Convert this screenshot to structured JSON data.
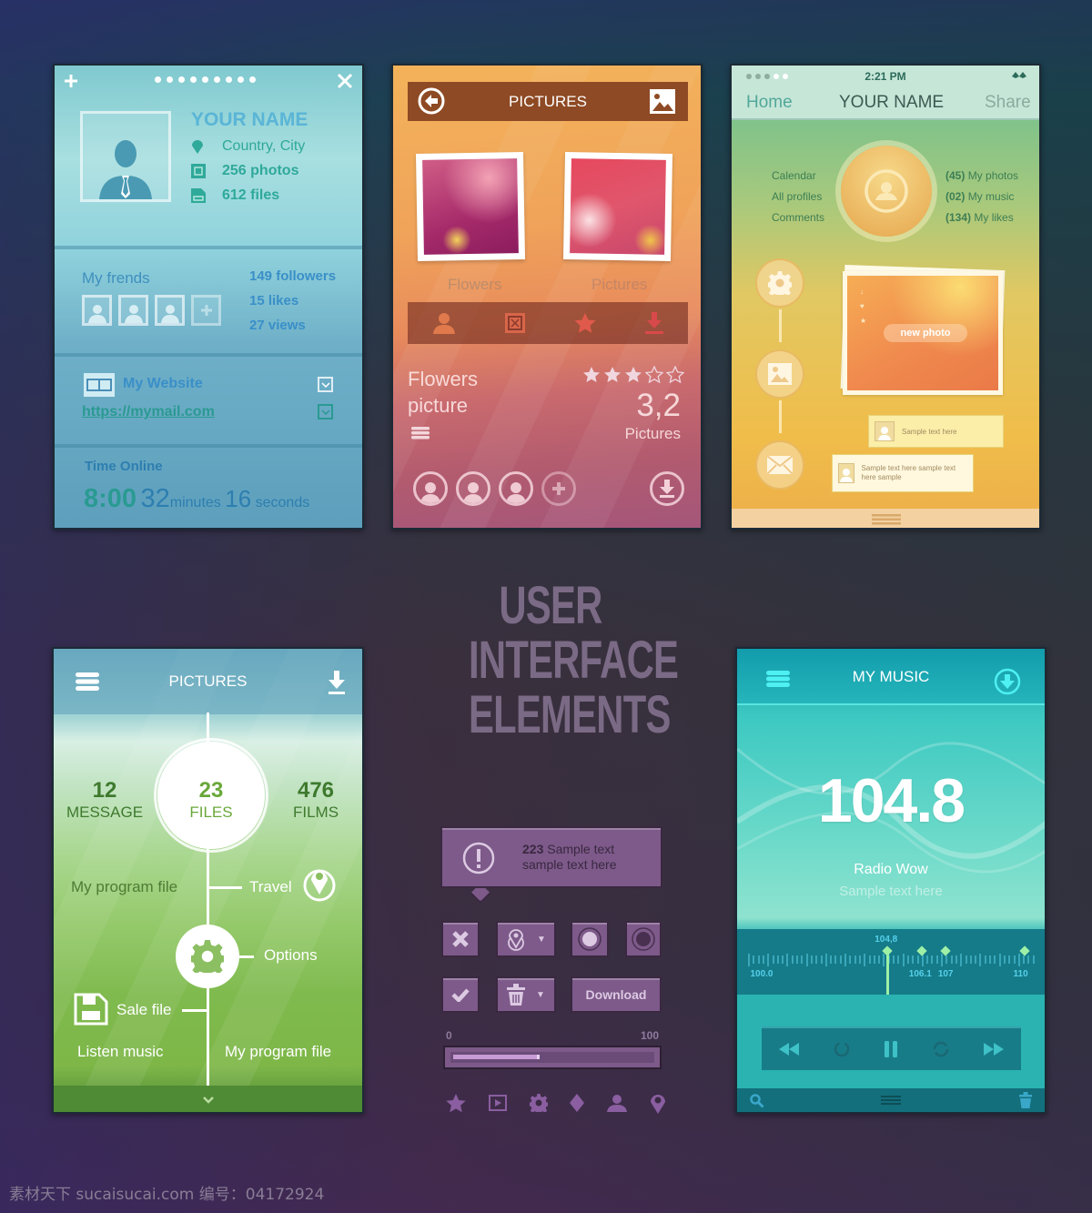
{
  "colors": {
    "profile_accent": "#5ab5d6",
    "orange_bar": "#8e4a24",
    "purple_widget": "#7d5a8a",
    "music_accent": "#58e5de",
    "tuner_marker": "#9ef0a6"
  },
  "profile_card": {
    "icons": {
      "add": "plus-icon",
      "close": "close-icon"
    },
    "page_dots": 9,
    "name": "YOUR NAME",
    "location": "Country, City",
    "photos": "256 photos",
    "files": "612 files",
    "friends_label": "My frends",
    "followers": "149 followers",
    "likes": "15 likes",
    "views": "27 views",
    "website_label": "My Website",
    "website_url": "https://mymail.com",
    "time_online_label": "Time Online",
    "time_hours": "8:00",
    "time_minutes": "32",
    "minutes_label": "minutes",
    "time_seconds": "16",
    "seconds_label": "seconds"
  },
  "pictures_card": {
    "title": "PICTURES",
    "photos": [
      {
        "label": "Flowers"
      },
      {
        "label": "Pictures"
      }
    ],
    "toolbar_icons": [
      "user-icon",
      "resize-icon",
      "star-icon",
      "download-icon"
    ],
    "item_title_line1": "Flowers",
    "item_title_line2": "picture",
    "rating": 3,
    "rating_max": 5,
    "rating_value": "3,2",
    "rating_label": "Pictures"
  },
  "social_card": {
    "status_time": "2:21 PM",
    "signal_dots_total": 5,
    "signal_dots_active": 3,
    "nav_home": "Home",
    "nav_title": "YOUR NAME",
    "nav_share": "Share",
    "left_menu": [
      "Calendar",
      "All profiles",
      "Comments"
    ],
    "right_stats": [
      {
        "count": "(45)",
        "label": "My photos"
      },
      {
        "count": "(02)",
        "label": "My music"
      },
      {
        "count": "(134)",
        "label": "My likes"
      }
    ],
    "new_photo_label": "new photo",
    "bubble1": "Sample text here",
    "bubble2": "Sample text here sample text here sample"
  },
  "files_card": {
    "title": "PICTURES",
    "stats": [
      {
        "value": "12",
        "label": "MESSAGE"
      },
      {
        "value": "23",
        "label": "FILES"
      },
      {
        "value": "476",
        "label": "FILMS"
      }
    ],
    "items": {
      "program_left": "My program file",
      "travel": "Travel",
      "options": "Options",
      "save": "Sale file",
      "listen": "Listen music",
      "program_right": "My program file"
    }
  },
  "center": {
    "title_lines": [
      "USER",
      "INTERFACE",
      "ELEMENTS"
    ],
    "alert_count": "223",
    "alert_text_1": "Sample text",
    "alert_text_2": "sample text here",
    "download_label": "Download",
    "progress_min": "0",
    "progress_max": "100",
    "progress_value": 45,
    "icon_row": [
      "star-icon",
      "play-icon",
      "gear-icon",
      "diamond-icon",
      "user-icon",
      "location-icon"
    ]
  },
  "music_card": {
    "title": "MY MUSIC",
    "frequency": "104.8",
    "station": "Radio Wow",
    "subtitle": "Sample text here",
    "tuner_current": "104,8",
    "tuner_labels": [
      "100.0",
      "106.1",
      "107",
      "110"
    ],
    "tuner_range": [
      99.5,
      110.5
    ],
    "tuner_presets": [
      106.1,
      107,
      110
    ],
    "tuner_value": 104.8
  },
  "watermark": "素材天下 sucaisucai.com  编号：04172924"
}
